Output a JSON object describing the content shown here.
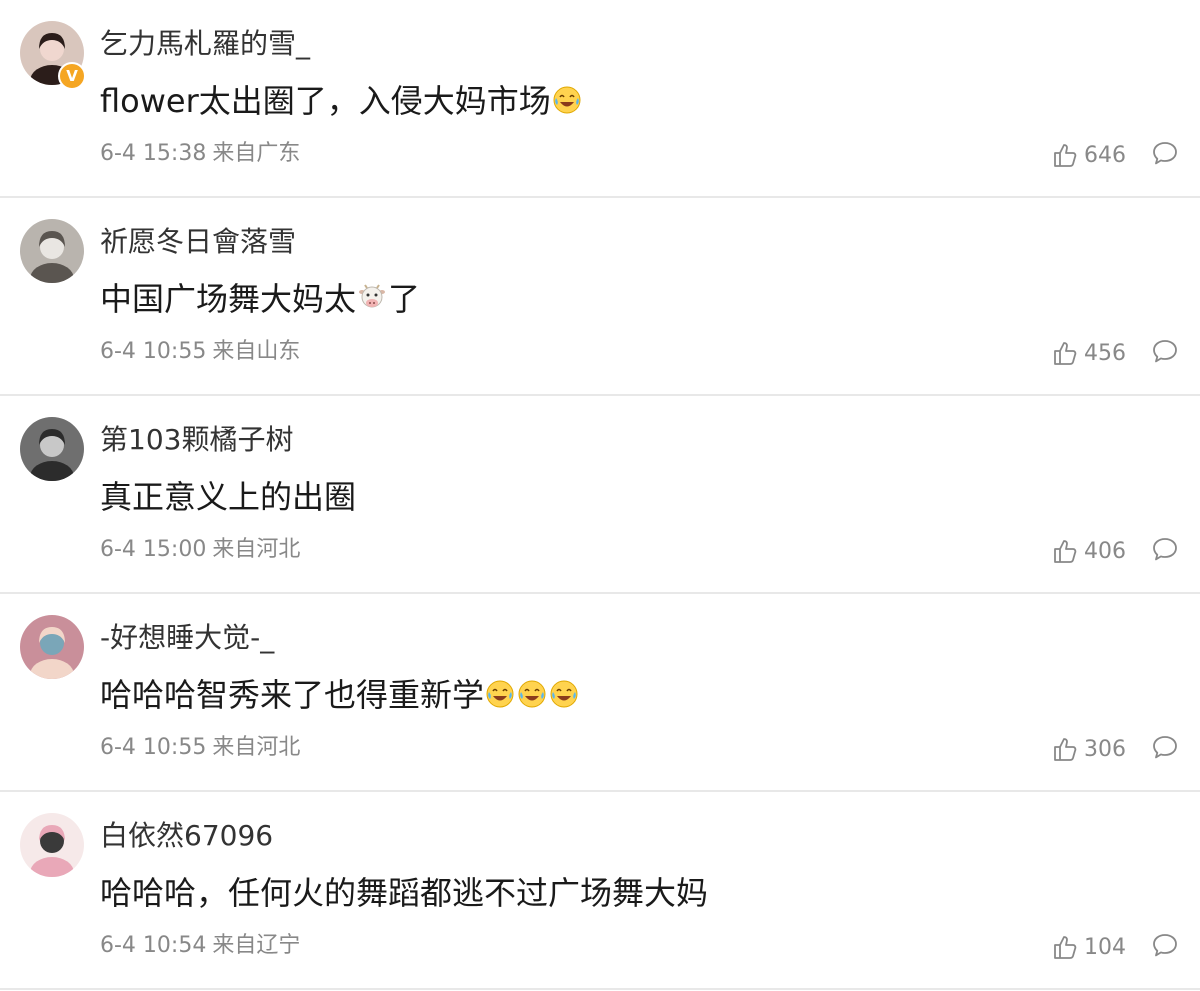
{
  "comments": [
    {
      "username": "乞力馬札羅的雪_",
      "verified": true,
      "verified_badge": "V",
      "text_parts": [
        "flower太出圈了，入侵大妈市场"
      ],
      "emojis": [
        "laugh-cry-emoji"
      ],
      "time": "6-4 15:38",
      "location": "来自广东",
      "likes": "646",
      "avatar_colors": [
        "#d9c6bd",
        "#2b1d1a",
        "#f0d7cf"
      ]
    },
    {
      "username": "祈愿冬日會落雪",
      "verified": false,
      "text_parts": [
        "中国广场舞大妈太",
        "了"
      ],
      "emojis": [
        "cow-emoji"
      ],
      "time": "6-4 10:55",
      "location": "来自山东",
      "likes": "456",
      "avatar_colors": [
        "#b9b4ae",
        "#5a5550",
        "#e9e6e2"
      ]
    },
    {
      "username": "第103颗橘子树",
      "verified": false,
      "text_parts": [
        "真正意义上的出圈"
      ],
      "emojis": [],
      "time": "6-4 15:00",
      "location": "来自河北",
      "likes": "406",
      "avatar_colors": [
        "#6f6f6f",
        "#2c2c2c",
        "#c8c8c8"
      ]
    },
    {
      "username": "-好想睡大觉-_",
      "verified": false,
      "text_parts": [
        "哈哈哈智秀来了也得重新学"
      ],
      "emojis": [
        "laugh-cry-emoji",
        "laugh-cry-emoji",
        "laugh-cry-emoji"
      ],
      "time": "6-4 10:55",
      "location": "来自河北",
      "likes": "306",
      "avatar_colors": [
        "#c98f9a",
        "#f2d6c9",
        "#7aa6b8"
      ]
    },
    {
      "username": "白依然67096",
      "verified": false,
      "text_parts": [
        "哈哈哈，任何火的舞蹈都逃不过广场舞大妈"
      ],
      "emojis": [],
      "time": "6-4 10:54",
      "location": "来自辽宁",
      "likes": "104",
      "avatar_colors": [
        "#f6e9e9",
        "#e9a8b8",
        "#3a3a3a"
      ]
    }
  ],
  "icons": {
    "like": "thumbs-up-icon",
    "reply": "comment-bubble-icon"
  },
  "colors": {
    "meta_text": "#888888",
    "divider": "#e8e8e8",
    "verified_badge": "#f5a623"
  }
}
